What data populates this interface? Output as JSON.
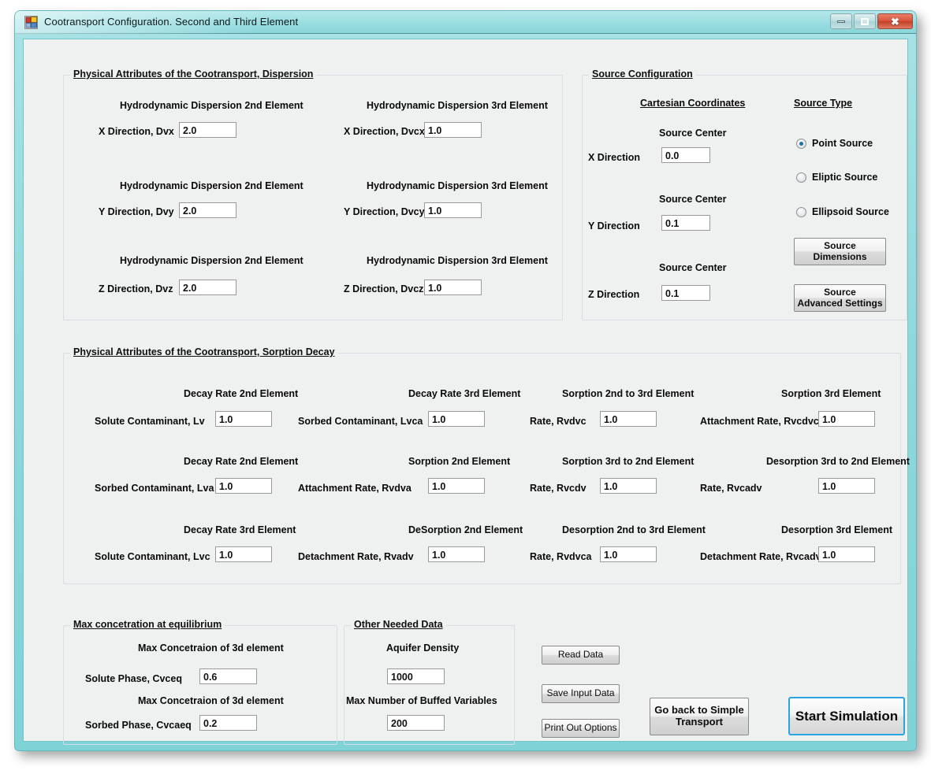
{
  "window": {
    "title": "Cootransport  Configuration. Second and Third Element",
    "icon": "app-window-icon",
    "buttons": {
      "minimize": "minimize-icon",
      "maximize": "maximize-icon",
      "close": "✖"
    }
  },
  "dispersion": {
    "group_title": "Physical Attributes of the Cootransport, Dispersion",
    "rows": [
      {
        "left_header": "Hydrodynamic Dispersion 2nd Element",
        "left_label": "X  Direction, Dvx",
        "left_value": "2.0",
        "right_header": "Hydrodynamic Dispersion 3rd Element",
        "right_label": "X  Direction, Dvcx",
        "right_value": "1.0"
      },
      {
        "left_header": "Hydrodynamic Dispersion 2nd Element",
        "left_label": "Y  Direction, Dvy",
        "left_value": "2.0",
        "right_header": "Hydrodynamic Dispersion 3rd Element",
        "right_label": "Y  Direction, Dvcy",
        "right_value": "1.0"
      },
      {
        "left_header": "Hydrodynamic Dispersion 2nd Element",
        "left_label": "Z  Direction, Dvz",
        "left_value": "2.0",
        "right_header": "Hydrodynamic Dispersion 3rd Element",
        "right_label": "Z  Direction, Dvcz",
        "right_value": "1.0"
      }
    ]
  },
  "source": {
    "group_title": "Source Configuration",
    "cartesian_header": "Cartesian Coordinates",
    "source_type_header": "Source Type",
    "coords": [
      {
        "center_label": "Source Center",
        "direction": "X  Direction",
        "value": "0.0"
      },
      {
        "center_label": "Source Center",
        "direction": "Y  Direction",
        "value": "0.1"
      },
      {
        "center_label": "Source Center",
        "direction": "Z  Direction",
        "value": "0.1"
      }
    ],
    "types": [
      {
        "label": "Point Source",
        "checked": true
      },
      {
        "label": "Eliptic Source",
        "checked": false
      },
      {
        "label": "Ellipsoid Source",
        "checked": false
      }
    ],
    "dimensions_button": "Source\nDimensions",
    "dimensions_button_line1": "Source",
    "dimensions_button_line2": "Dimensions",
    "advanced_button_line1": "Source",
    "advanced_button_line2": "Advanced Settings"
  },
  "sorption": {
    "group_title": "Physical Attributes of the Cootransport,  Sorption Decay",
    "cells": [
      {
        "header": "Decay Rate 2nd Element",
        "label": "Solute  Contaminant, Lv",
        "value": "1.0",
        "col": 0,
        "row": 0
      },
      {
        "header": "Decay Rate 3rd Element",
        "label": "Sorbed Contaminant, Lvca",
        "value": "1.0",
        "col": 1,
        "row": 0
      },
      {
        "header": "Sorption 2nd to 3rd Element",
        "label": "Rate, Rvdvc",
        "value": "1.0",
        "col": 2,
        "row": 0
      },
      {
        "header": "Sorption 3rd Element",
        "label": "Attachment Rate, Rvcdvca",
        "value": "1.0",
        "col": 3,
        "row": 0
      },
      {
        "header": "Decay Rate 2nd Element",
        "label": "Sorbed Contaminant, Lva",
        "value": "1.0",
        "col": 0,
        "row": 1
      },
      {
        "header": "Sorption 2nd Element",
        "label": "Attachment Rate, Rvdva",
        "value": "1.0",
        "col": 1,
        "row": 1
      },
      {
        "header": "Sorption 3rd to 2nd Element",
        "label": "Rate, Rvcdv",
        "value": "1.0",
        "col": 2,
        "row": 1
      },
      {
        "header": "Desorption 3rd to 2nd Element",
        "label": "Rate, Rvcadv",
        "value": "1.0",
        "col": 3,
        "row": 1
      },
      {
        "header": "Decay Rate 3rd Element",
        "label": "Solute  Contaminant, Lvc",
        "value": "1.0",
        "col": 0,
        "row": 2
      },
      {
        "header": "DeSorption 2nd Element",
        "label": "Detachment Rate, Rvadv",
        "value": "1.0",
        "col": 1,
        "row": 2
      },
      {
        "header": "Desorption 2nd to 3rd Element",
        "label": "Rate, Rvdvca",
        "value": "1.0",
        "col": 2,
        "row": 2
      },
      {
        "header": "Desorption 3rd Element",
        "label": "Detachment Rate, Rvcadvc",
        "value": "1.0",
        "col": 3,
        "row": 2
      }
    ]
  },
  "equilibrium": {
    "group_title": "Max concetration at equilibrium",
    "rows": [
      {
        "header": "Max  Concetraion of 3d element",
        "label": "Solute Phase, Cvceq",
        "value": "0.6"
      },
      {
        "header": "Max  Concetraion of 3d element",
        "label": "Sorbed Phase, Cvcaeq",
        "value": "0.2"
      }
    ]
  },
  "other_data": {
    "group_title": "Other Needed Data",
    "rows": [
      {
        "header": "Aquifer Density",
        "value": "1000"
      },
      {
        "header": "Max Number of Buffed Variables",
        "value": "200"
      }
    ]
  },
  "actions": {
    "read_data": "Read  Data",
    "save_input_data": "Save  Input Data",
    "print_out_options": "Print Out Options",
    "go_back_line1": "Go back to  Simple",
    "go_back_line2": "Transport",
    "start_simulation": "Start Simulation"
  },
  "colors": {
    "titlebar": "#8ed8dc",
    "accent": "#2aa4e0",
    "client_bg": "#eff0f0",
    "close_button": "#d6553a"
  }
}
